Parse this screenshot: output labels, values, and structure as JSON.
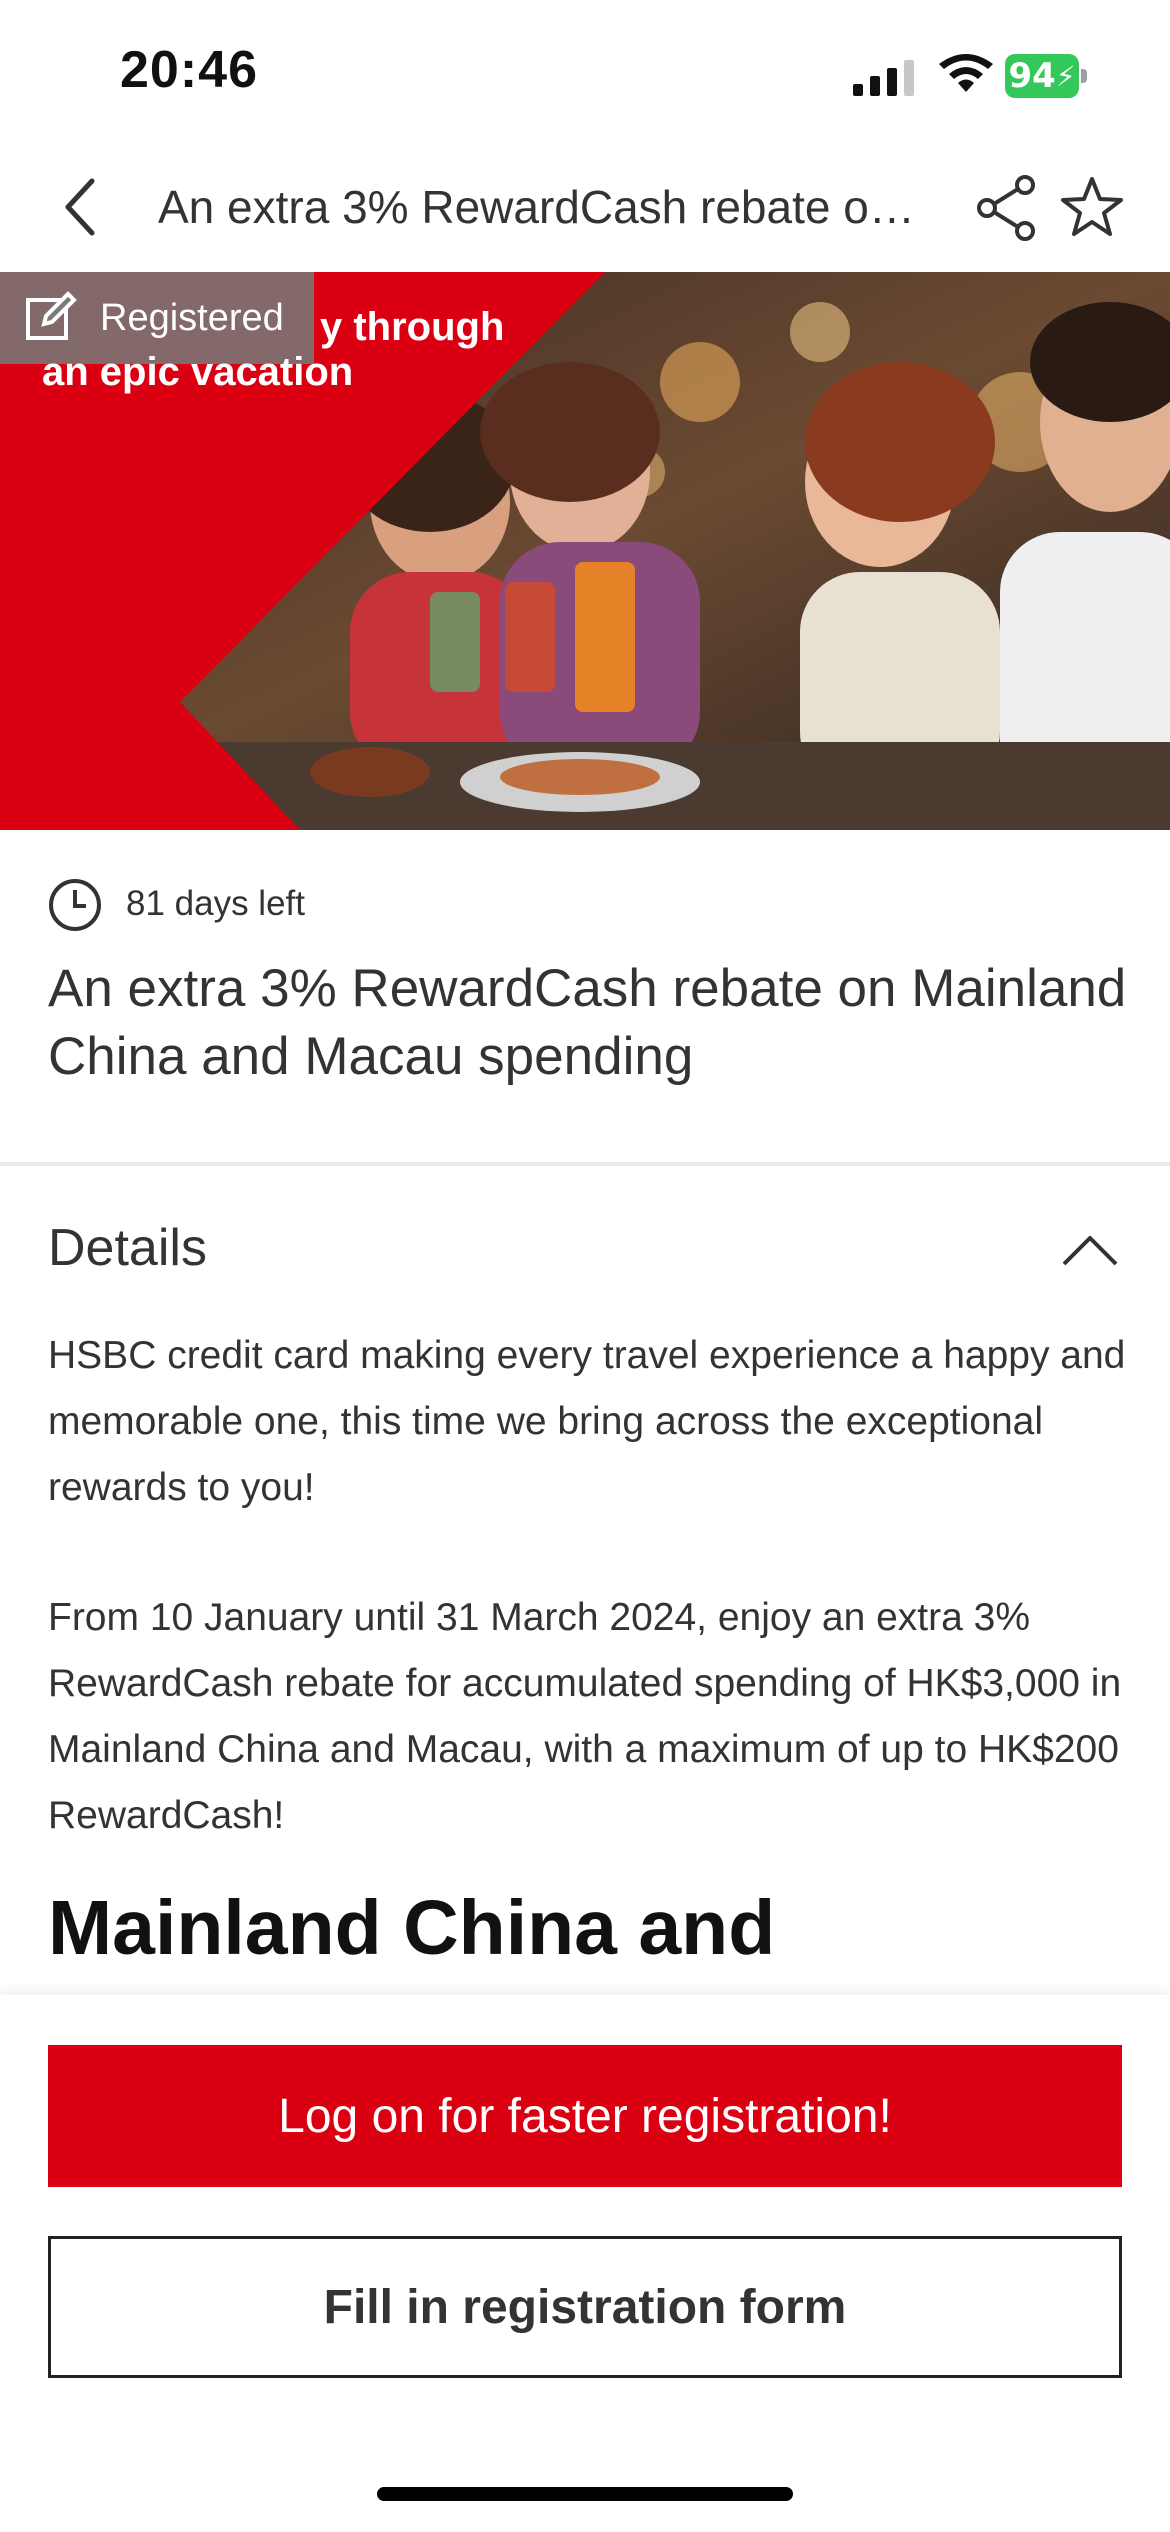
{
  "status_bar": {
    "time": "20:46",
    "battery_percent": "94",
    "icons": [
      "cellular-signal-icon",
      "wifi-icon",
      "battery-charging-icon"
    ]
  },
  "nav": {
    "title": "An extra 3% RewardCash rebate on Mainland China and Macau spending",
    "icons": [
      "back-chevron-icon",
      "share-icon",
      "star-icon"
    ]
  },
  "hero": {
    "badge_label": "Registered",
    "badge_icon": "edit-icon",
    "caption_line1": "y through",
    "caption_line2": "an epic vacation"
  },
  "offer": {
    "days_left": "81 days left",
    "title": "An extra 3% RewardCash rebate on Mainland China and Macau spending"
  },
  "details": {
    "heading": "Details",
    "paragraph1": "HSBC credit card making every travel experience a happy and memorable one, this time we bring across the exceptional rewards to you!",
    "paragraph2": "From 10 January until 31 March 2024, enjoy an extra 3% RewardCash rebate for accumulated spending of HK$3,000 in Mainland China and Macau, with a maximum of up to HK$200 RewardCash!",
    "section_heading": "Mainland China and"
  },
  "actions": {
    "login_label": "Log on for faster registration!",
    "form_label": "Fill in registration form"
  },
  "colors": {
    "brand_red": "#db0011",
    "battery_green": "#34c759"
  }
}
